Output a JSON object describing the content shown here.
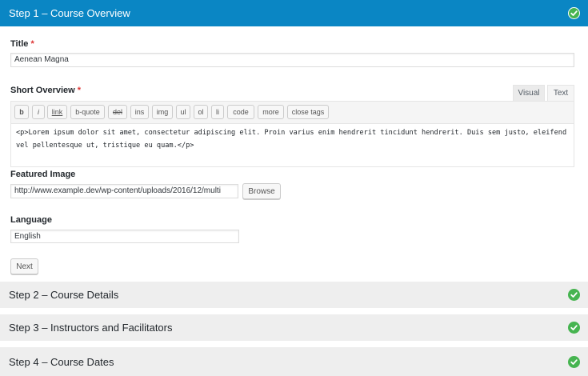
{
  "steps": [
    {
      "label": "Step 1 – Course Overview",
      "complete": true
    },
    {
      "label": "Step 2 – Course Details",
      "complete": true
    },
    {
      "label": "Step 3 – Instructors and Facilitators",
      "complete": true
    },
    {
      "label": "Step 4 – Course Dates",
      "complete": true
    }
  ],
  "form": {
    "title_label": "Title",
    "title_value": "Aenean Magna",
    "overview_label": "Short Overview",
    "required_mark": "*",
    "editor_tabs": {
      "visual": "Visual",
      "text": "Text"
    },
    "quicktags": [
      "b",
      "i",
      "link",
      "b-quote",
      "del",
      "ins",
      "img",
      "ul",
      "ol",
      "li",
      "code",
      "more",
      "close tags"
    ],
    "overview_content": "<p>Lorem ipsum dolor sit amet, consectetur adipiscing elit. Proin varius enim hendrerit tincidunt hendrerit. Duis sem justo, eleifend vel pellentesque ut, tristique eu quam.</p>",
    "featured_image_label": "Featured Image",
    "featured_image_value": "http://www.example.dev/wp-content/uploads/2016/12/multi",
    "browse_label": "Browse",
    "language_label": "Language",
    "language_value": "English",
    "next_label": "Next"
  },
  "colors": {
    "active_header": "#0a86c4",
    "collapsed_header": "#eeeeee",
    "check_green": "#46b450",
    "required_red": "#dc3232"
  },
  "icons": {
    "step_complete": "check-circle-icon"
  }
}
